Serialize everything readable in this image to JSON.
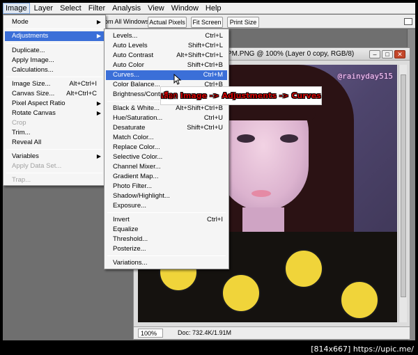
{
  "menubar": {
    "items": [
      "Image",
      "Layer",
      "Select",
      "Filter",
      "Analysis",
      "View",
      "Window",
      "Help"
    ]
  },
  "options_bar": {
    "fit_label": "om All Windows",
    "actual_pixels": "Actual Pixels",
    "fit_screen": "Fit Screen",
    "print_size": "Print Size"
  },
  "image_menu": [
    {
      "label": "Mode",
      "submenu": true
    },
    {
      "label": "Adjustments",
      "submenu": true,
      "highlighted": true
    },
    {
      "label": "Duplicate..."
    },
    {
      "label": "Apply Image..."
    },
    {
      "label": "Calculations..."
    },
    {
      "label": "Image Size...",
      "shortcut": "Alt+Ctrl+I"
    },
    {
      "label": "Canvas Size...",
      "shortcut": "Alt+Ctrl+C"
    },
    {
      "label": "Pixel Aspect Ratio",
      "submenu": true
    },
    {
      "label": "Rotate Canvas",
      "submenu": true
    },
    {
      "label": "Crop",
      "disabled": true
    },
    {
      "label": "Trim..."
    },
    {
      "label": "Reveal All"
    },
    {
      "label": "Variables",
      "submenu": true
    },
    {
      "label": "Apply Data Set...",
      "disabled": true
    },
    {
      "label": "Trap...",
      "disabled": true
    }
  ],
  "adjustments_menu": [
    {
      "label": "Levels...",
      "shortcut": "Ctrl+L"
    },
    {
      "label": "Auto Levels",
      "shortcut": "Shift+Ctrl+L"
    },
    {
      "label": "Auto Contrast",
      "shortcut": "Alt+Shift+Ctrl+L"
    },
    {
      "label": "Auto Color",
      "shortcut": "Shift+Ctrl+B"
    },
    {
      "label": "Curves...",
      "shortcut": "Ctrl+M",
      "highlighted": true
    },
    {
      "label": "Color Balance...",
      "shortcut": "Ctrl+B"
    },
    {
      "label": "Brightness/Contr"
    },
    {
      "label": "Black & White...",
      "shortcut": "Alt+Shift+Ctrl+B"
    },
    {
      "label": "Hue/Saturation...",
      "shortcut": "Ctrl+U"
    },
    {
      "label": "Desaturate",
      "shortcut": "Shift+Ctrl+U"
    },
    {
      "label": "Match Color..."
    },
    {
      "label": "Replace Color..."
    },
    {
      "label": "Selective Color..."
    },
    {
      "label": "Channel Mixer..."
    },
    {
      "label": "Gradient Map..."
    },
    {
      "label": "Photo Filter..."
    },
    {
      "label": "Shadow/Highlight..."
    },
    {
      "label": "Exposure..."
    },
    {
      "label": "Invert",
      "shortcut": "Ctrl+I"
    },
    {
      "label": "Equalize"
    },
    {
      "label": "Threshold..."
    },
    {
      "label": "Posterize..."
    },
    {
      "label": "Variations..."
    }
  ],
  "document": {
    "title": "PM.PNG @ 100% (Layer 0 copy, RGB/8)",
    "watermark": "@rainyday515",
    "zoom": "100%",
    "doc_size": "Doc: 732.4K/1.91M"
  },
  "annotation": {
    "text": "เลือก Image -> Adjustments -> Curves"
  },
  "footer": "[814x667] https://upic.me/",
  "colors": {
    "highlight": "#3b6fd8",
    "annotation_text": "#d10000"
  }
}
